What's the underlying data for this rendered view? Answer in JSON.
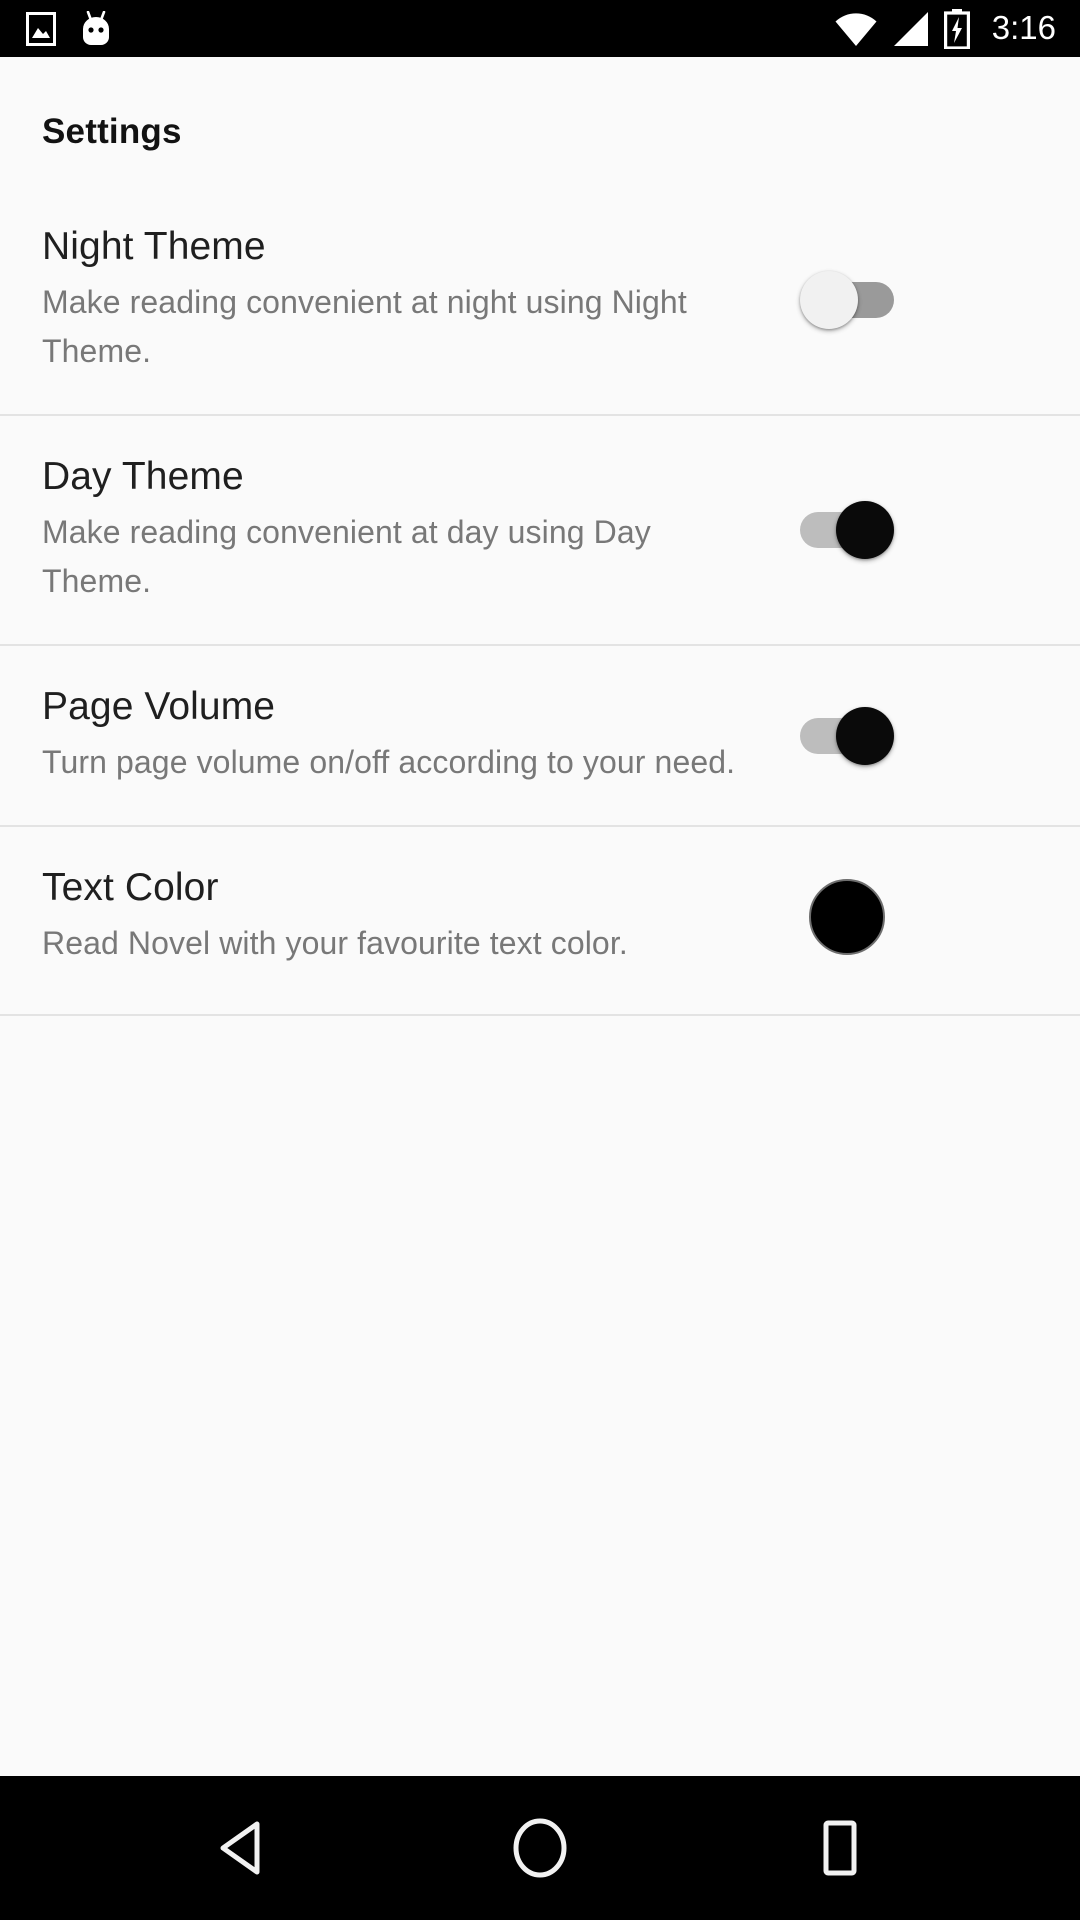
{
  "status_bar": {
    "left_icons": [
      {
        "name": "screenshot-image-icon",
        "glyph": "image"
      },
      {
        "name": "android-marshmallow-icon",
        "glyph": "android-head"
      }
    ],
    "right_icons": [
      {
        "name": "wifi-icon",
        "glyph": "wifi"
      },
      {
        "name": "cellular-signal-icon",
        "glyph": "signal"
      },
      {
        "name": "battery-charging-icon",
        "glyph": "battery-charging"
      }
    ],
    "clock": "3:16",
    "background_color": "#000000",
    "foreground_color": "#ffffff"
  },
  "header": {
    "title": "Settings"
  },
  "settings": {
    "items": [
      {
        "id": "night-theme",
        "title": "Night Theme",
        "description": "Make reading convenient at night using Night Theme.",
        "control": "switch",
        "state": "off"
      },
      {
        "id": "day-theme",
        "title": "Day Theme",
        "description": "Make reading convenient at day using Day Theme.",
        "control": "switch",
        "state": "on"
      },
      {
        "id": "page-volume",
        "title": "Page Volume",
        "description": "Turn page volume on/off according to your need.",
        "control": "switch",
        "state": "on"
      },
      {
        "id": "text-color",
        "title": "Text Color",
        "description": "Read Novel with your favourite text color.",
        "control": "color-swatch",
        "swatch_color": "#000000"
      }
    ]
  },
  "nav_bar": {
    "buttons": [
      {
        "name": "back-button",
        "glyph": "triangle-left"
      },
      {
        "name": "home-button",
        "glyph": "circle"
      },
      {
        "name": "recents-button",
        "glyph": "square"
      }
    ],
    "background_color": "#000000"
  },
  "colors": {
    "page_background": "#fafafa",
    "title_text": "#1f1f1f",
    "description_text": "#787878",
    "divider": "#e3e3e3",
    "switch_on_thumb": "#0a0a0a",
    "switch_on_track": "#bdbdbd",
    "switch_off_thumb": "#f1f1f1",
    "switch_off_track": "#9a9a9a"
  }
}
